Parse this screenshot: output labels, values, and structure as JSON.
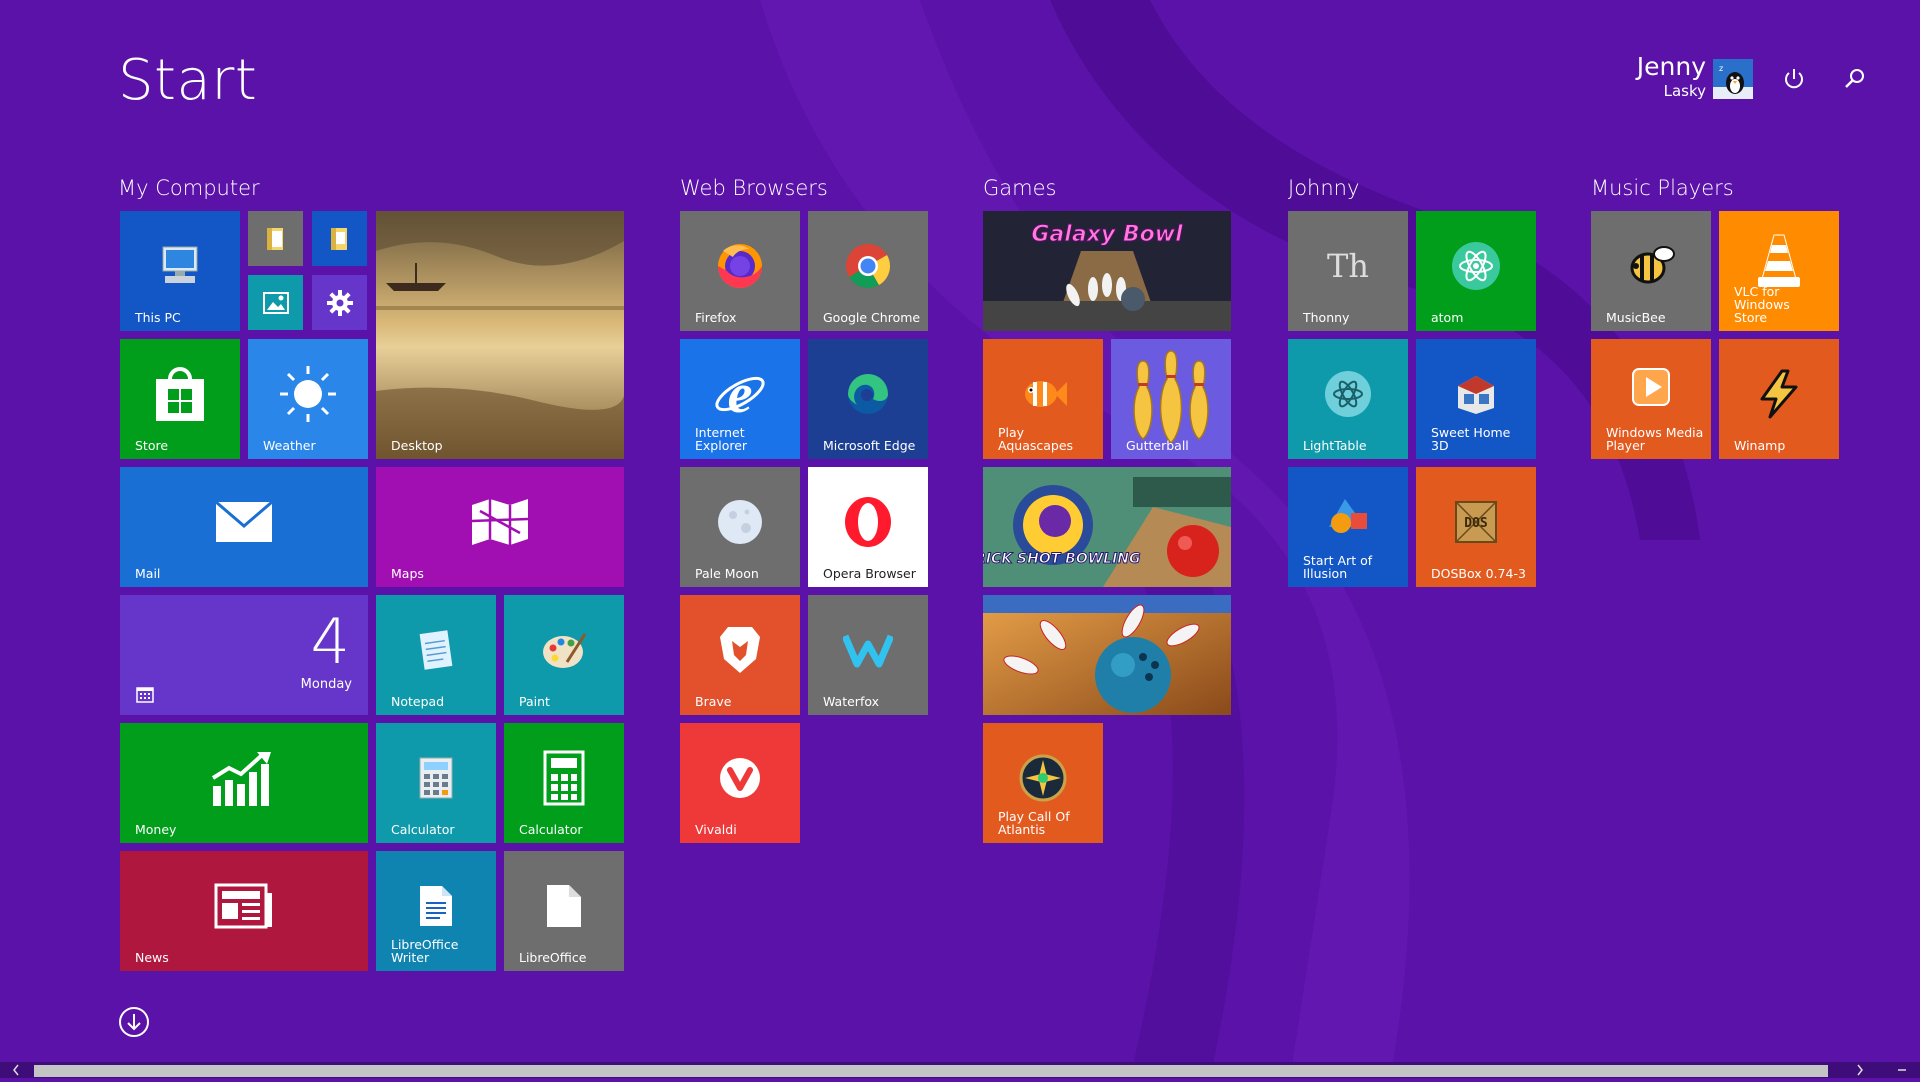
{
  "start": {
    "title": "Start"
  },
  "user": {
    "first_name": "Jenny",
    "last_name": "Lasky"
  },
  "colors": {
    "background": "#5b12a8",
    "blue": "#1356c5",
    "cobalt": "#1a56d0",
    "teal": "#0f9aab",
    "green": "#009e1a",
    "magenta": "#a10fb2",
    "violet": "#6635c9",
    "gray": "#6e6e6e",
    "orange": "#e35a1f",
    "red": "#b0173f",
    "vivaldi": "#ef3939",
    "vlc": "#ff8b00"
  },
  "groups": {
    "my_computer": {
      "label": "My Computer"
    },
    "web_browsers": {
      "label": "Web Browsers"
    },
    "games": {
      "label": "Games"
    },
    "johnny": {
      "label": "Johnny"
    },
    "music_players": {
      "label": "Music Players"
    }
  },
  "tiles": {
    "this_pc": "This PC",
    "store": "Store",
    "weather": "Weather",
    "desktop": "Desktop",
    "mail": "Mail",
    "maps": "Maps",
    "calendar": {
      "number": "4",
      "day": "Monday"
    },
    "notepad": "Notepad",
    "paint": "Paint",
    "money": "Money",
    "calculator_1": "Calculator",
    "calculator_2": "Calculator",
    "news": "News",
    "libreoffice_writer": "LibreOffice\nWriter",
    "libreoffice": "LibreOffice",
    "firefox": "Firefox",
    "chrome": "Google Chrome",
    "ie": "Internet Explorer",
    "edge": "Microsoft Edge",
    "pale_moon": "Pale Moon",
    "opera": "Opera Browser",
    "brave": "Brave",
    "waterfox": "Waterfox",
    "vivaldi": "Vivaldi",
    "galaxy_bowl": "Galaxy Bowl",
    "aquascapes": "Play Aquascapes",
    "gutterball": "Gutterball",
    "trick_shot": "TRICK SHOT BOWLING",
    "call_of_atlantis": "Play Call Of\nAtlantis",
    "thonny": "Thonny",
    "thonny_glyph": "Th",
    "atom": "atom",
    "lighttable": "LightTable",
    "sweet_home": "Sweet Home 3D",
    "art_of_illusion": "Start Art of\nIllusion",
    "dosbox": "DOSBox 0.74-3",
    "dosbox_glyph": "DOS",
    "musicbee": "MusicBee",
    "vlc": "VLC for Windows\nStore",
    "wmp": "Windows Media\nPlayer",
    "winamp": "Winamp"
  }
}
